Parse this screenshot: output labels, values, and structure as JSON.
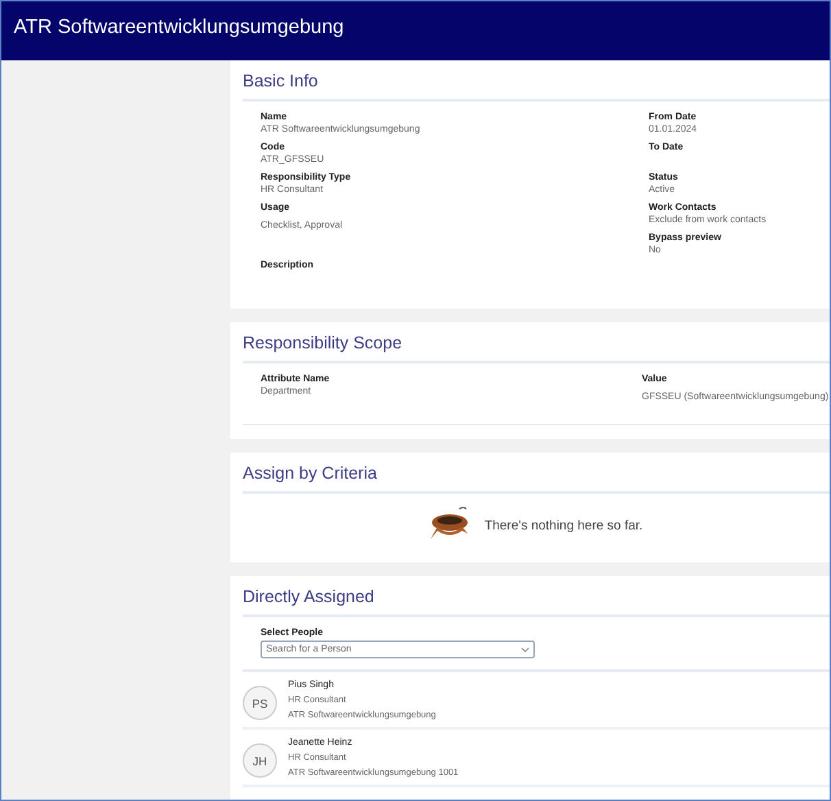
{
  "header": {
    "title": "ATR Softwareentwicklungsumgebung"
  },
  "basic_info": {
    "title": "Basic Info",
    "left_fields": [
      {
        "label": "Name",
        "value": "ATR Softwareentwicklungsumgebung"
      },
      {
        "label": "Code",
        "value": "ATR_GFSSEU"
      },
      {
        "label": "Responsibility Type",
        "value": "HR Consultant"
      },
      {
        "label": "Usage",
        "value": "Checklist, Approval"
      },
      {
        "label": "Description"
      }
    ],
    "right_fields": [
      {
        "label": "From Date",
        "value": "01.01.2024"
      },
      {
        "label": "To Date"
      },
      {
        "label": "Status",
        "value": "Active"
      },
      {
        "label": "Work Contacts",
        "value": "Exclude from work contacts"
      },
      {
        "label": "Bypass preview",
        "value": "No"
      }
    ]
  },
  "responsibility_scope": {
    "title": "Responsibility Scope",
    "columns": [
      "Attribute Name",
      "Value"
    ],
    "rows": [
      [
        "Department",
        "GFSSEU (Softwareentwicklungsumgebung)"
      ]
    ]
  },
  "assign_by_criteria": {
    "title": "Assign by Criteria",
    "empty_message": "There's nothing here so far."
  },
  "directly_assigned": {
    "title": "Directly Assigned",
    "select_label": "Select People",
    "search": {
      "placeholder": "Search for a Person"
    },
    "people": [
      {
        "initials": "PS",
        "name": "Pius Singh",
        "role": "HR Consultant",
        "responsibility": "ATR Softwareentwicklungsumgebung"
      },
      {
        "initials": "JH",
        "name": "Jeanette Heinz",
        "role": "HR Consultant",
        "responsibility": "ATR Softwareentwicklungsumgebung 1001"
      }
    ]
  }
}
